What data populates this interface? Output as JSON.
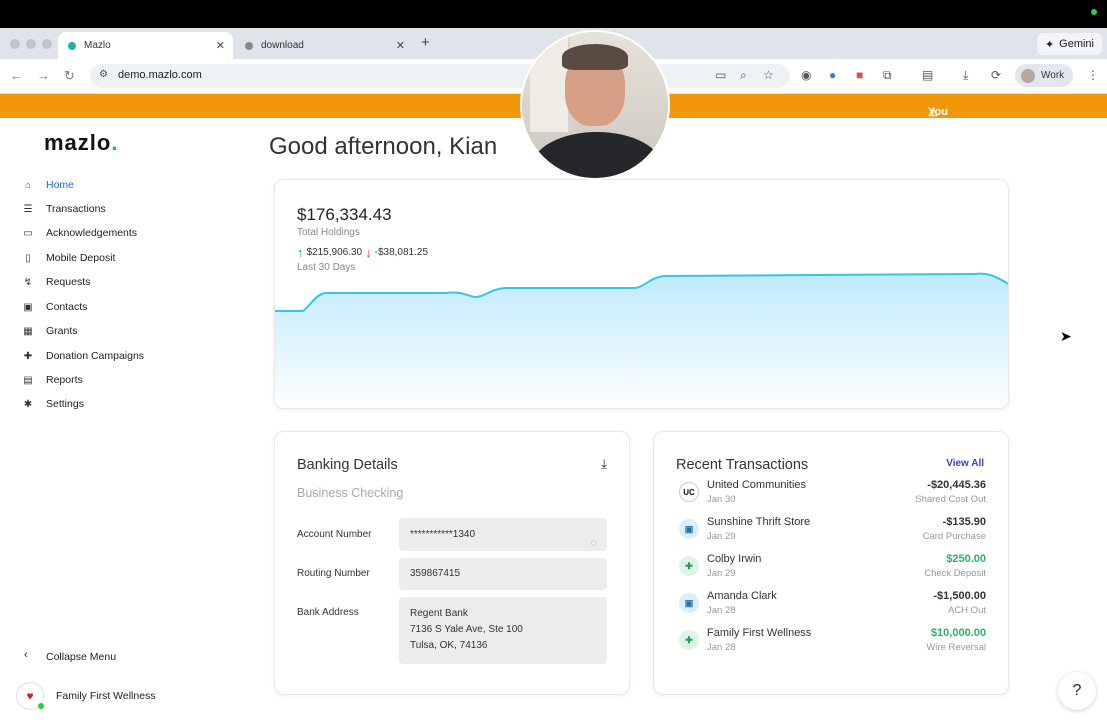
{
  "browser": {
    "tabs": [
      {
        "label": "Mazlo",
        "active": true
      },
      {
        "label": "download",
        "active": false
      }
    ],
    "url": "demo.mazlo.com",
    "gemini_label": "Gemini",
    "profile_label": "Work"
  },
  "banner": {
    "text": "You are"
  },
  "sidebar": {
    "logo_text": "mazlo",
    "logo_dot": ".",
    "items": [
      {
        "label": "Home",
        "icon": "home-icon",
        "active": true
      },
      {
        "label": "Transactions",
        "icon": "list-icon"
      },
      {
        "label": "Acknowledgements",
        "icon": "card-icon"
      },
      {
        "label": "Mobile Deposit",
        "icon": "check-icon"
      },
      {
        "label": "Requests",
        "icon": "request-icon"
      },
      {
        "label": "Contacts",
        "icon": "contacts-icon"
      },
      {
        "label": "Grants",
        "icon": "grants-icon"
      },
      {
        "label": "Donation Campaigns",
        "icon": "donation-icon"
      },
      {
        "label": "Reports",
        "icon": "reports-icon"
      },
      {
        "label": "Settings",
        "icon": "gear-icon"
      }
    ],
    "collapse_label": "Collapse Menu",
    "org_name": "Family First Wellness"
  },
  "main": {
    "greeting": "Good afternoon, Kian",
    "holdings": {
      "amount": "$176,334.43",
      "label": "Total Holdings",
      "inflow": "$215,906.30",
      "outflow": "-$38,081.25",
      "period": "Last 30 Days",
      "colors": {
        "line": "#37c4ea",
        "fill": "#c9efff"
      }
    },
    "banking": {
      "title": "Banking Details",
      "account_type": "Business Checking",
      "account_number_label": "Account Number",
      "account_number": "***********1340",
      "routing_number_label": "Routing Number",
      "routing_number": "359867415",
      "bank_address_label": "Bank Address",
      "bank_address_lines": [
        "Regent Bank",
        "7136 S Yale Ave, Ste 100",
        "Tulsa, OK, 74136"
      ]
    },
    "transactions": {
      "title": "Recent Transactions",
      "view_all": "View All",
      "rows": [
        {
          "name": "United Communities",
          "date": "Jan 30",
          "amount": "-$20,445.36",
          "type": "Shared Cost Out",
          "icon": "uc-logo-icon",
          "icon_text": "UC",
          "positive": false
        },
        {
          "name": "Sunshine Thrift Store",
          "date": "Jan 29",
          "amount": "-$135.90",
          "type": "Card Purchase",
          "icon": "contact-card-icon",
          "icon_text": "▣",
          "positive": false
        },
        {
          "name": "Colby Irwin",
          "date": "Jan 29",
          "amount": "$250.00",
          "type": "Check Deposit",
          "icon": "donation-hand-icon",
          "icon_text": "✚",
          "positive": true
        },
        {
          "name": "Amanda Clark",
          "date": "Jan 28",
          "amount": "-$1,500.00",
          "type": "ACH Out",
          "icon": "contact-card-icon",
          "icon_text": "▣",
          "positive": false
        },
        {
          "name": "Family First Wellness",
          "date": "Jan 28",
          "amount": "$10,000.00",
          "type": "Wire Reversal",
          "icon": "donation-hand-icon",
          "icon_text": "✚",
          "positive": true
        }
      ]
    }
  },
  "colors": {
    "accent": "#1f66d0",
    "banner": "#f2960a",
    "positive": "#2ab06a",
    "link": "#3443c8"
  }
}
